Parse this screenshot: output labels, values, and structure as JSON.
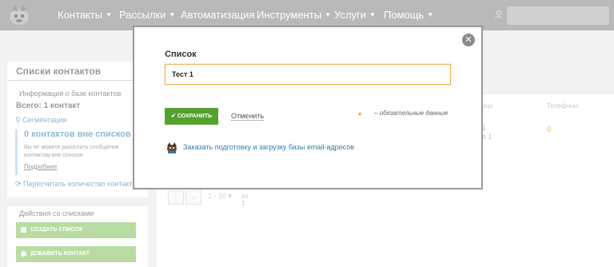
{
  "nav": {
    "items": [
      {
        "label": "Контакты",
        "caret": true
      },
      {
        "label": "Рассылки",
        "caret": true
      },
      {
        "label": "Автоматизация",
        "caret": false
      },
      {
        "label": "Инструменты",
        "caret": true
      },
      {
        "label": "Услуги",
        "caret": true
      },
      {
        "label": "Помощь",
        "caret": true
      }
    ]
  },
  "sidebar": {
    "title": "Списки контактов",
    "info_legend": "Информация о базе контактов",
    "total": "Всего: 1 контакт",
    "segmentation": "Сегментация",
    "outside_lists_title": "0 контактов вне списков",
    "outside_lists_text": "Вы не можете разослать сообщения контактам вне списков",
    "details_link": "Подробнее",
    "recount": "Пересчитать количество контактов",
    "actions_legend": "Действия со списками",
    "create_list": "СОЗДАТЬ СПИСОК",
    "add_contact": "ДОБАВИТЬ КОНТАКТ"
  },
  "main": {
    "col_partial": "ицо",
    "col_phones": "Телефоны",
    "row_partial_1": "1",
    "row_partial_2": "а 1",
    "row_count": "0",
    "pager_range": "1 - 10",
    "pager_of": "из 1"
  },
  "modal": {
    "label": "Список",
    "input_value": "Тест 1",
    "save_label": "✔ СОХРАНИТЬ",
    "cancel_label": "Отменить",
    "asterisk": "*",
    "required_note": "– обязательные данные",
    "order_link": "Заказать подготовку и загрузку базы email-адресов"
  },
  "colors": {
    "accent_green": "#54a22d",
    "link_blue": "#2c7fb5",
    "input_border": "#f0b250"
  }
}
